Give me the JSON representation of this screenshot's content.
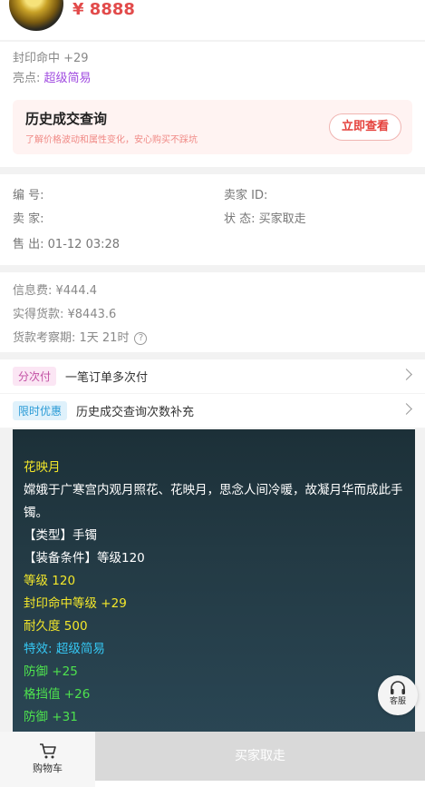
{
  "header": {
    "price": "¥ 8888"
  },
  "summary": {
    "line1": "封印命中 +29",
    "highlight_label": "亮点:",
    "highlight_value": "超级简易"
  },
  "history": {
    "title": "历史成交查询",
    "subtitle": "了解价格波动和属性变化，安心购买不踩坑",
    "button": "立即查看"
  },
  "detail": {
    "id_label": "编 号:",
    "seller_id_label": "卖家 ID:",
    "seller_label": "卖 家:",
    "status_label": "状 态:",
    "status_value": "买家取走",
    "sold_label": "售 出:",
    "sold_value": "01-12 03:28"
  },
  "fees": {
    "info_fee": "信息费: ¥444.4",
    "received": "实得货款: ¥8443.6",
    "period": "货款考察期: 1天 21时",
    "help_icon": "question-circle-icon"
  },
  "promos": [
    {
      "tag": "分次付",
      "text": "一笔订单多次付"
    },
    {
      "tag": "限时优惠",
      "text": "历史成交查询次数补充"
    }
  ],
  "description": {
    "name": "花映月",
    "text": "嫦娥于广寒宫内观月照花、花映月，思念人间冷暖，故凝月华而成此手镯。",
    "type": "【类型】手镯",
    "requirement": "【装备条件】等级120",
    "level": "等级 120",
    "seal_hit": "封印命中等级 +29",
    "durability": "耐久度 500",
    "special": "特效: 超级简易",
    "defense1": "防御 +25",
    "block": "格挡值 +26",
    "defense2": "防御 +31"
  },
  "service": {
    "label": "客服",
    "icon": "headset-icon"
  },
  "bottom": {
    "cart_label": "购物车",
    "cart_icon": "shopping-cart-icon",
    "buy_label": "买家取走"
  }
}
